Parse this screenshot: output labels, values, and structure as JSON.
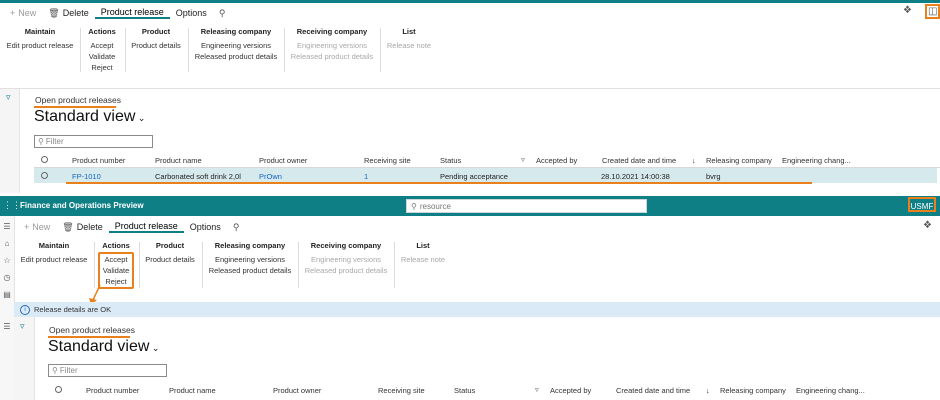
{
  "top": {
    "actions": {
      "new_label": "New",
      "delete_label": "Delete"
    },
    "tabs": [
      "Product release",
      "Options"
    ],
    "groups": {
      "maintain": {
        "title": "Maintain",
        "items": [
          "Edit product release"
        ]
      },
      "actions": {
        "title": "Actions",
        "items": [
          "Accept",
          "Validate",
          "Reject"
        ]
      },
      "product": {
        "title": "Product",
        "items": [
          "Product details"
        ]
      },
      "releasing": {
        "title": "Releasing company",
        "items": [
          "Engineering versions",
          "Released product details"
        ]
      },
      "receiving": {
        "title": "Receiving company",
        "items": [
          "Engineering versions",
          "Released product details"
        ]
      },
      "list": {
        "title": "List",
        "items": [
          "Release note"
        ]
      }
    },
    "breadcrumb": "Open product releases",
    "view_title": "Standard view",
    "filter_placeholder": "Filter",
    "columns": [
      "Product number",
      "Product name",
      "Product owner",
      "Receiving site",
      "Status",
      "Accepted by",
      "Created date and time",
      "Releasing company",
      "Engineering chang..."
    ],
    "row": {
      "product_number": "FP-1010",
      "product_name": "Carbonated soft drink 2,0l",
      "product_owner": "PrOwn",
      "receiving_site": "1",
      "status": "Pending acceptance",
      "accepted_by": "",
      "created": "28.10.2021 14:00:38",
      "releasing_company": "bvrg"
    }
  },
  "appbar": {
    "title": "Finance and Operations Preview",
    "search_placeholder": "resource",
    "company": "USMF"
  },
  "bottom": {
    "actions": {
      "new_label": "New",
      "delete_label": "Delete"
    },
    "tabs": [
      "Product release",
      "Options"
    ],
    "groups": {
      "maintain": {
        "title": "Maintain",
        "items": [
          "Edit product release"
        ]
      },
      "actions": {
        "title": "Actions",
        "items": [
          "Accept",
          "Validate",
          "Reject"
        ]
      },
      "product": {
        "title": "Product",
        "items": [
          "Product details"
        ]
      },
      "releasing": {
        "title": "Releasing company",
        "items": [
          "Engineering versions",
          "Released product details"
        ]
      },
      "receiving": {
        "title": "Receiving company",
        "items": [
          "Engineering versions",
          "Released product details"
        ]
      },
      "list": {
        "title": "List",
        "items": [
          "Release note"
        ]
      }
    },
    "message": "Release details are OK",
    "breadcrumb": "Open product releases",
    "view_title": "Standard view",
    "filter_placeholder": "Filter",
    "columns": [
      "Product number",
      "Product name",
      "Product owner",
      "Receiving site",
      "Status",
      "Accepted by",
      "Created date and time",
      "Releasing company",
      "Engineering chang..."
    ]
  },
  "colors": {
    "accent": "#0f7f86",
    "highlight": "#e8801b",
    "selected_row": "#d6eaee"
  },
  "icons": [
    "plus-icon",
    "trash-icon",
    "search-icon",
    "filter-icon",
    "sort-desc-icon",
    "info-icon",
    "waffle-icon",
    "diamond-icon",
    "panel-icon",
    "chevron-down-icon"
  ]
}
